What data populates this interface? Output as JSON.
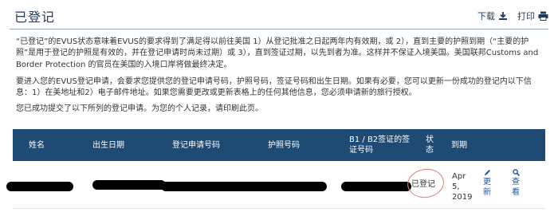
{
  "page": {
    "title": "已登记",
    "actions": {
      "download_label": "下载",
      "print_label": "打印"
    }
  },
  "content": {
    "paragraph1": "“已登记”的EVUS状态意味着EVUS的要求得到了满足得以前往美国 1）从登记批准之日起两年内有效期，或 2），直到主要的护照到期（“主要的护照”是用于登记的护照是有效的，并在登记申请时尚未过期）或 3），直到签证过期，以先到者为准。这样并不保证入境美国。美国联邦Customs and Border Protection 的官员在美国的入境口岸将做最终决定。",
    "paragraph2": "要进入您的EVUS登记申请，会要求您提供您的登记申请号码，护照号码，签证号码和出生日期。如果有必要，您可以更新一份成功的登记内以下信息：1）在美地址和2）电子邮件地址。如果您需要更改或更新表格上的任何其他信息，您必须申请新的旅行授权。",
    "paragraph3": "您已成功提交了以下所列的登记申请。为您的个人记录，请印刷此页。"
  },
  "table": {
    "headers": {
      "name": "姓名",
      "dob": "出生日期",
      "application_number": "登记申请号码",
      "passport_number": "护照号码",
      "visa_number": "B1 / B2签证的签证号码",
      "status": "状态",
      "expiry": "到期"
    },
    "row": {
      "status": "已登记",
      "expiry": "Apr 5, 2019",
      "update_label": "更新",
      "view_label": "查看"
    }
  },
  "colors": {
    "header_bg": "#1e4a73",
    "title": "#1f3a5c",
    "link": "#1f5aa0",
    "annotation_circle": "#d9827e"
  }
}
